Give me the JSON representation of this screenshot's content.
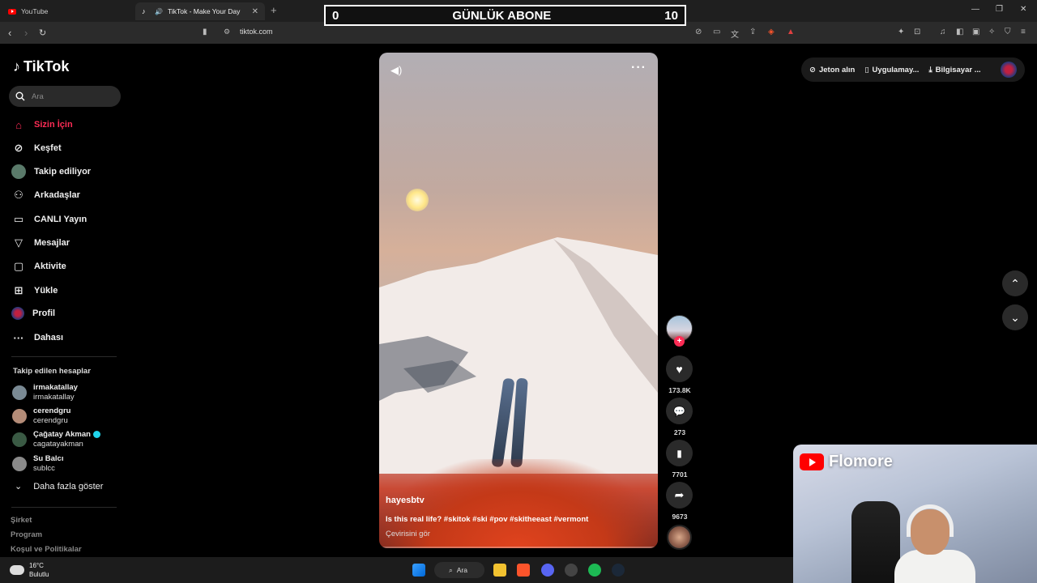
{
  "browser": {
    "tabs": [
      {
        "label": "YouTube",
        "active": false
      },
      {
        "label": "TikTok - Make Your Day",
        "active": true
      }
    ],
    "url": "tiktok.com"
  },
  "overlay": {
    "left_count": "0",
    "title": "GÜNLÜK ABONE",
    "right_count": "10"
  },
  "sidebar": {
    "logo": "TikTok",
    "search_placeholder": "Ara",
    "nav": [
      {
        "label": "Sizin İçin",
        "icon": "home-icon",
        "active": true
      },
      {
        "label": "Keşfet",
        "icon": "compass-icon"
      },
      {
        "label": "Takip ediliyor",
        "icon": "avatar-icon"
      },
      {
        "label": "Arkadaşlar",
        "icon": "friends-icon"
      },
      {
        "label": "CANLI Yayın",
        "icon": "live-icon"
      },
      {
        "label": "Mesajlar",
        "icon": "send-icon"
      },
      {
        "label": "Aktivite",
        "icon": "activity-icon"
      },
      {
        "label": "Yükle",
        "icon": "upload-icon"
      },
      {
        "label": "Profil",
        "icon": "profile-icon"
      },
      {
        "label": "Dahası",
        "icon": "more-icon"
      }
    ],
    "following_title": "Takip edilen hesaplar",
    "accounts": [
      {
        "name": "irmakatallay",
        "handle": "irmakatallay"
      },
      {
        "name": "cerendgru",
        "handle": "cerendgru"
      },
      {
        "name": "Çağatay Akman",
        "handle": "cagatayakman",
        "verified": true
      },
      {
        "name": "Su Balcı",
        "handle": "sublcc"
      }
    ],
    "show_more": "Daha fazla göster",
    "footer": [
      "Şirket",
      "Program",
      "Koşul ve Politikalar"
    ]
  },
  "video": {
    "username": "hayesbtv",
    "caption": "Is this real life? #skitok #ski #pov #skitheeast #vermont",
    "translate": "Çevirisini gör"
  },
  "actions": {
    "likes": "173.8K",
    "comments": "273",
    "saves": "7701",
    "shares": "9673"
  },
  "topbar": {
    "coins": "Jeton alın",
    "app": "Uygulamay...",
    "desktop": "Bilgisayar ..."
  },
  "webcam": {
    "channel": "Flomore"
  },
  "taskbar": {
    "temp": "16°C",
    "weather": "Bulutlu",
    "search": "Ara"
  }
}
